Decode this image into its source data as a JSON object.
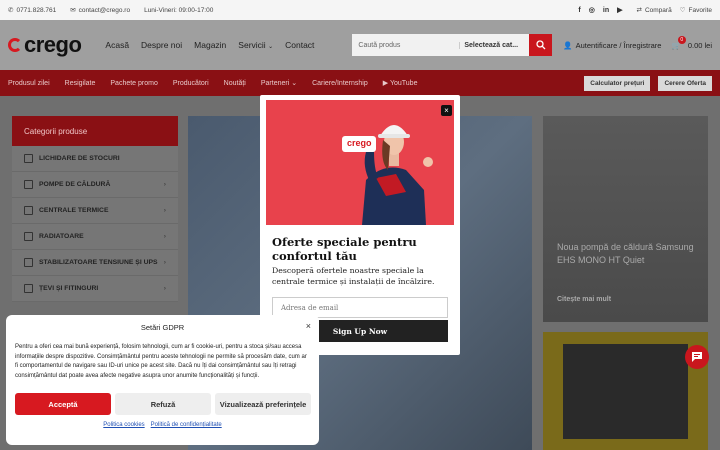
{
  "topbar": {
    "phone": "0771.828.761",
    "email": "contact@crego.ro",
    "hours": "Luni-Vineri: 09:00-17:00",
    "social": [
      "f",
      "◎",
      "in",
      "▶"
    ],
    "compare": "Compară",
    "favorites": "Favorite"
  },
  "header": {
    "logo": "crego",
    "nav": [
      "Acasă",
      "Despre noi",
      "Magazin",
      "Servicii",
      "Contact"
    ],
    "search_placeholder": "Caută produs",
    "search_category": "Selectează cat...",
    "account": "Autentificare / Înregistrare",
    "cart_count": "0",
    "cart_total": "0.00 lei"
  },
  "menu": {
    "items": [
      "Produsul zilei",
      "Resigilate",
      "Pachete promo",
      "Producători",
      "Noutăți",
      "Parteneri",
      "Cariere/Internship",
      "YouTube"
    ],
    "buttons": [
      "Calculator prețuri",
      "Cerere Oferta"
    ]
  },
  "sidebar": {
    "heading": "Categorii produse",
    "categories": [
      "LICHIDARE DE STOCURI",
      "POMPE DE CĂLDURĂ",
      "CENTRALE TERMICE",
      "RADIATOARE",
      "STABILIZATOARE TENSIUNE ȘI UPS",
      "ȚEVI ȘI FITINGURI"
    ]
  },
  "promo": {
    "title": "Noua pompă de căldură Samsung EHS MONO HT Quiet",
    "link": "Citește mai mult"
  },
  "modal": {
    "title": "Oferte speciale pentru confortul tău",
    "description": "Descoperă ofertele noastre speciale la centrale termice și instalații de încălzire.",
    "email_placeholder": "Adresa de email",
    "signup": "Sign Up Now",
    "close": "×",
    "image_logo": "crego"
  },
  "gdpr": {
    "title": "Setări GDPR",
    "body": "Pentru a oferi cea mai bună experiență, folosim tehnologii, cum ar fi cookie-uri, pentru a stoca și/sau accesa informațiile despre dispozitive. Consimțământul pentru aceste tehnologii ne permite să procesăm date, cum ar fi comportamentul de navigare sau ID-uri unice pe acest site. Dacă nu îți dai consimțământul sau îți retragi consimțământul dat poate avea afecte negative asupra unor anumite funcționalități și funcții.",
    "accept": "Acceptă",
    "refuse": "Refuză",
    "preferences": "Vizualizează preferințele",
    "cookie_policy": "Politica cookies",
    "privacy_policy": "Politică de confidențialitate"
  },
  "colors": {
    "brand_red": "#d71920",
    "dark_red": "#8a1014",
    "modal_image_bg": "#e8424c"
  }
}
